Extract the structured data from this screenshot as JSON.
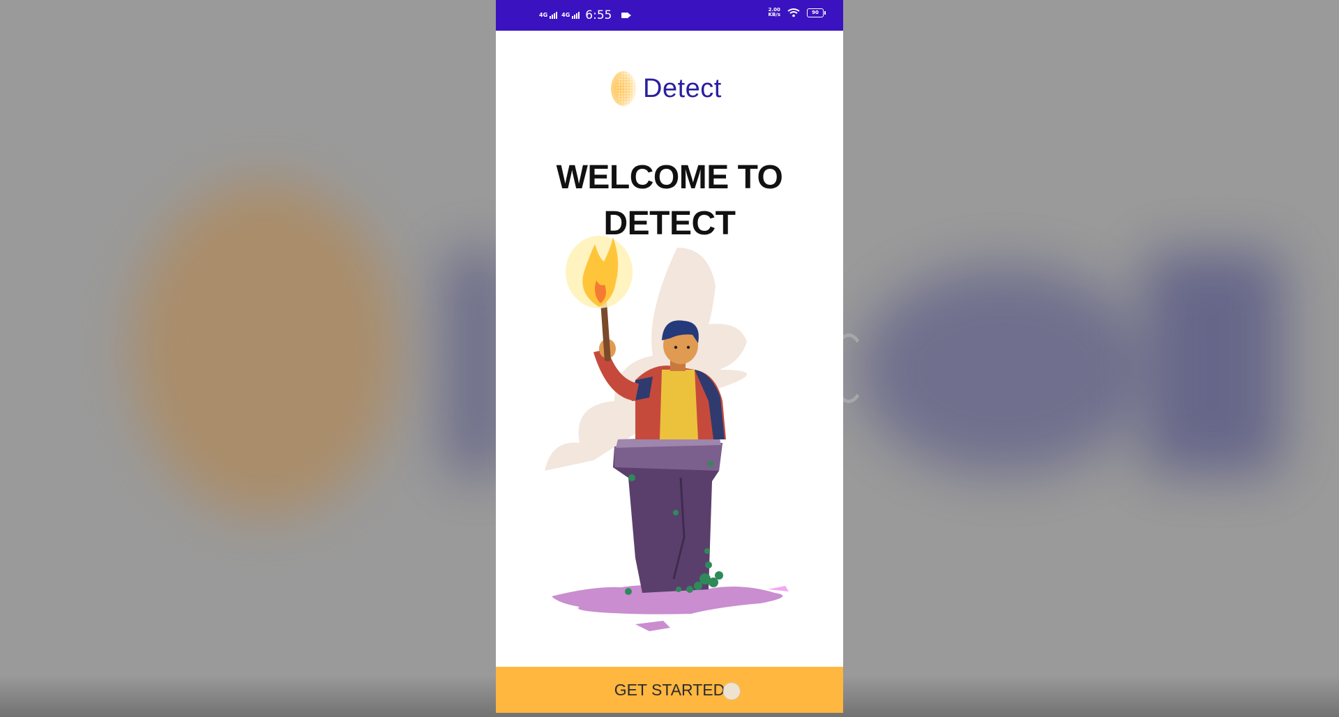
{
  "status_bar": {
    "network_1": "4G",
    "network_2": "4G",
    "time": "6:55",
    "speed_value": "2.00",
    "speed_unit": "KB/s",
    "battery": "90"
  },
  "app": {
    "logo_text": "Detect",
    "welcome_title": "WELCOME TO DETECT",
    "cta_label": "GET STARTED"
  },
  "colors": {
    "status_bar": "#3a12c0",
    "brand_text": "#2a1f9e",
    "cta_background": "#ffb740"
  }
}
